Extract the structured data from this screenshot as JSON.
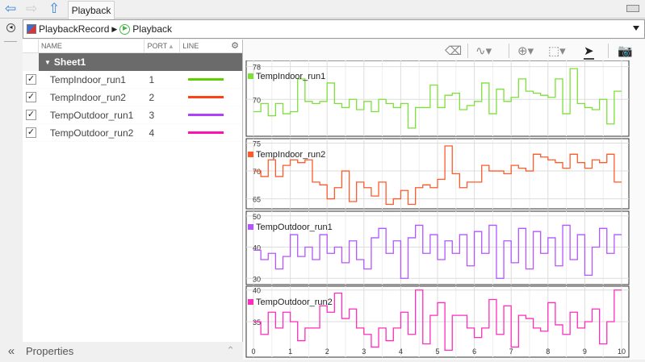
{
  "tab": {
    "label": "Playback"
  },
  "breadcrumb": [
    "PlaybackRecord",
    "Playback"
  ],
  "table": {
    "headers": {
      "name": "NAME",
      "port": "PORT",
      "line": "LINE"
    },
    "group": "Sheet1",
    "rows": [
      {
        "name": "TempIndoor_run1",
        "port": "1",
        "color": "#5fd000",
        "checked": true
      },
      {
        "name": "TempIndoor_run2",
        "port": "2",
        "color": "#ff4010",
        "checked": true
      },
      {
        "name": "TempOutdoor_run1",
        "port": "3",
        "color": "#b040ff",
        "checked": true
      },
      {
        "name": "TempOutdoor_run2",
        "port": "4",
        "color": "#ff10b0",
        "checked": true
      }
    ]
  },
  "properties_label": "Properties",
  "toolbar": [
    "eraser-icon",
    "signal-icon",
    "zoom-icon",
    "fit-icon",
    "cursor-icon",
    "camera-icon"
  ],
  "chart_data": [
    {
      "type": "line",
      "step": true,
      "name": "TempIndoor_run1",
      "color": "#7de03a",
      "xlim": [
        0,
        10
      ],
      "ylim": [
        61,
        79.5
      ],
      "yticks": [
        70,
        78
      ],
      "values": [
        67,
        69,
        66,
        69,
        66.5,
        67,
        75,
        69.5,
        69,
        69.5,
        74,
        69,
        68,
        70,
        67.5,
        69.5,
        67,
        70,
        69,
        68,
        69,
        63,
        68,
        68,
        73.5,
        68,
        71,
        71.5,
        67.5,
        68.5,
        69.5,
        74,
        66.5,
        72.5,
        69.5,
        70.5,
        75,
        72,
        71.5,
        71,
        70.5,
        75,
        66.5,
        77.5,
        69,
        68,
        67.5,
        70,
        64,
        72
      ]
    },
    {
      "type": "line",
      "step": true,
      "name": "TempIndoor_run2",
      "color": "#ff5a2a",
      "xlim": [
        0,
        10
      ],
      "ylim": [
        63.2,
        75.8
      ],
      "yticks": [
        65,
        70,
        75
      ],
      "values": [
        70,
        69,
        72,
        69,
        71,
        72,
        71.5,
        72,
        68,
        67.5,
        65,
        67,
        70,
        64.5,
        68,
        67,
        65.5,
        68,
        64,
        65,
        66.5,
        64,
        67,
        67.5,
        67,
        68.5,
        74.5,
        69.5,
        67,
        68,
        68,
        71,
        70,
        70,
        69.5,
        71,
        70.5,
        70,
        73,
        72.5,
        72,
        71.5,
        70.5,
        73,
        71.5,
        70.5,
        72,
        71.5,
        73,
        68
      ]
    },
    {
      "type": "line",
      "step": true,
      "name": "TempOutdoor_run1",
      "color": "#b455ff",
      "xlim": [
        0,
        10
      ],
      "ylim": [
        28,
        51.5
      ],
      "yticks": [
        30,
        40,
        50
      ],
      "values": [
        39,
        36,
        38,
        33,
        37,
        44,
        37,
        40,
        36,
        44,
        38,
        40,
        35,
        42,
        36,
        33,
        43,
        46,
        38,
        42,
        30,
        43,
        47,
        38,
        44,
        36,
        42,
        38,
        44,
        34,
        45,
        38,
        47,
        30,
        42,
        35,
        46,
        33,
        45,
        38,
        43,
        34,
        47,
        36,
        44,
        31,
        40,
        46,
        38,
        44
      ]
    },
    {
      "type": "line",
      "step": true,
      "name": "TempOutdoor_run2",
      "color": "#ff2cbc",
      "xlim": [
        0,
        10
      ],
      "ylim": [
        29.4,
        40.6
      ],
      "yticks": [
        35,
        40
      ],
      "xticks": [
        0,
        1,
        2,
        3,
        4,
        5,
        6,
        7,
        8,
        9,
        10
      ],
      "values": [
        35,
        33,
        36.5,
        34,
        36.5,
        35,
        32,
        34,
        34,
        37.5,
        36.5,
        39.5,
        35.5,
        37,
        34,
        33,
        31,
        34,
        32,
        34,
        36.5,
        33,
        40,
        31.5,
        36,
        38,
        30.5,
        36,
        36,
        34,
        32.5,
        34,
        38.5,
        33,
        37.5,
        31,
        36,
        35.5,
        34,
        33.5,
        38,
        34.5,
        33,
        36.5,
        34,
        35,
        37,
        31.5,
        35,
        40
      ]
    }
  ]
}
